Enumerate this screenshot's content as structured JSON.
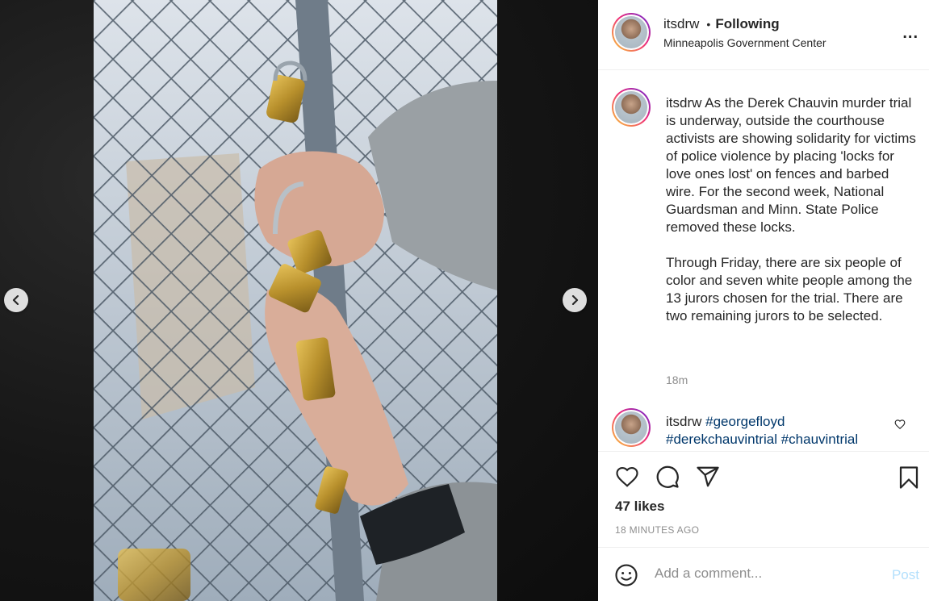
{
  "nav": {
    "prev_icon": "chevron-left-icon",
    "next_icon": "chevron-right-icon"
  },
  "header": {
    "username": "itsdrw",
    "dot": "•",
    "following_label": "Following",
    "location": "Minneapolis Government Center",
    "more_label": "..."
  },
  "caption": {
    "username": "itsdrw",
    "text": " As the Derek Chauvin murder trial is underway, outside the courthouse activists are showing solidarity for victims of police violence by placing 'locks for love ones lost' on fences and barbed wire. For the second week, National Guardsman and Minn. State Police removed these locks.\n\nThrough Friday, there are six people of color and seven white people among the 13 jurors chosen for the trial. There are two remaining jurors to be selected.",
    "time": "18m"
  },
  "comment2": {
    "username": "itsdrw",
    "tag1": "#georgefloyd",
    "tag2": "#derekchauvintrial",
    "tag3": "#chauvintrial"
  },
  "actions": {
    "likes": "47 likes",
    "post_time": "18 MINUTES AGO"
  },
  "add_comment": {
    "placeholder": "Add a comment...",
    "post_label": "Post"
  },
  "colors": {
    "accent": "#0095f6",
    "post_disabled": "#b2dffc",
    "link": "#00376b",
    "muted": "#8e8e8e"
  }
}
